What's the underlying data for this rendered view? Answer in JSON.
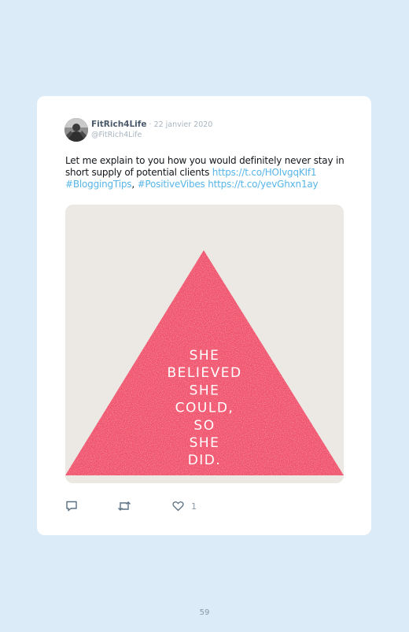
{
  "tweet": {
    "display_name": "FitRich4Life",
    "separator": " · ",
    "date": "22 janvier 2020",
    "handle": "@FitRich4Life",
    "text_plain": "Let me explain to you how you would definitely never stay in short supply of potential clients ",
    "link1": "https://t.co/HOIvgqKIf1",
    "hashtag1": "#BloggingTips",
    "comma": ", ",
    "hashtag2": "#PositiveVibes",
    "link2": "https://t.co/yevGhxn1ay",
    "image": {
      "quote_lines": [
        "SHE",
        "BELIEVED",
        "SHE",
        "COULD,",
        "SO",
        "SHE",
        "DID."
      ],
      "triangle_color": "#f0516b",
      "background_color": "#ece9e4"
    },
    "like_count": "1"
  },
  "icons": {
    "reply": "reply-icon",
    "retweet": "retweet-icon",
    "like": "heart-icon"
  },
  "colors": {
    "page_background": "#dcebf8",
    "link": "#57b5e8"
  },
  "page_number": "59"
}
